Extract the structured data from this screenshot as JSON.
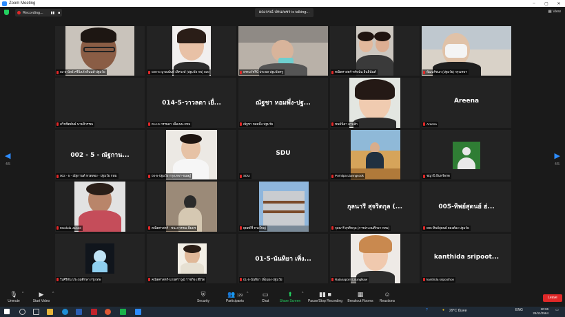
{
  "window": {
    "title": "Zoom Meeting",
    "ctrl_min": "–",
    "ctrl_max": "▢",
    "ctrl_close": "✕"
  },
  "topbar": {
    "recording": "Recording...",
    "pause": "▮▮",
    "stop": "■",
    "talking": "ผดงกรณ์ ปทนเพชร is talking...",
    "view": "View"
  },
  "nav": {
    "left_arrow": "◀",
    "right_arrow": "▶",
    "page_left": "4/5",
    "page_right": "4/5"
  },
  "tiles": [
    {
      "label": "02-5-นัทธ์ ศรีนิลภักดีนนท์-ปฐมวัย"
    },
    {
      "label": "020-5 ญาณนันท์ เลิศวงษ์ (ปฐมวัย กพ) 020"
    },
    {
      "label": "ธรรมวัชรินี ประพล ปฐมวัยครู"
    },
    {
      "label": "คณิตศาสตร์-ทรัพนัน อินธินันท์"
    },
    {
      "label": "พัฒนรัชนก (ปฐมวัย) กรุงเทพฯ"
    },
    {
      "label": "สวิชชิตพันธ์ นามจิวรรณ",
      "big": ""
    },
    {
      "label": "014-5-วรรพดา เนื่อเนพ-กทม",
      "big": "014-5-วาวลดา เยื่..."
    },
    {
      "label": "ณัฐชา หอมพึ่ง-ปฐมวัย",
      "big": "ณัฐชา หอมพึ่ง-ปฐ..."
    },
    {
      "label": "ชนม์นิสา อาบสัก"
    },
    {
      "label": "Areena",
      "big": "Areena"
    },
    {
      "label": "002 - 5 - ณัฐกานต์ ทวดทอง - ปฐมวัย กทม",
      "big": "002 - 5 - ณัฐกาน..."
    },
    {
      "label": "04-5-ปฐมวัย กรุงเทพฯ-ขนษฏ์"
    },
    {
      "label": "SDU",
      "big": "SDU"
    },
    {
      "label": "Porntipa Lianngsook"
    },
    {
      "label": "ชญานิ อินทร์พรต"
    },
    {
      "label": "Mookda Jaisee"
    },
    {
      "label": "คณิตศาสตร์ - ชนะกวรรณ พิมพร"
    },
    {
      "label": "ยุพดพีรี่-ทวงใหญ่"
    },
    {
      "label": "กุลนารี สุจริตกุล (การประถมศึกษา-กทม)",
      "big": "กุลนารี สุจริตกุล (..."
    },
    {
      "label": "005-ทิพย์สุดนย์ ฮองต์อง ปฐมวัย",
      "big": "005-ทิพย์สุดนย์ ฮ่..."
    },
    {
      "label": "ใบศิริพัน ประถมศึกษา กรุงเทพ"
    },
    {
      "label": "คณิตศาสตร์-นายศราวุฒิ ราชกิจ เจ๊ยิโต"
    },
    {
      "label": "01-5-นันทิยา เพิ่งแผง-ปฐมวัย",
      "big": "01-5-นันทิยา เพิ่ง..."
    },
    {
      "label": "Ratanaporn Lounglkaw"
    },
    {
      "label": "kanthida sripoothon",
      "big": "kanthida sripoot..."
    }
  ],
  "toolbar": {
    "unmute": "Unmute",
    "start_video": "Start Video",
    "security": "Security",
    "participants": "Participants",
    "participants_count": "129",
    "chat": "Chat",
    "share_screen": "Share Screen",
    "recording": "Pause/Stop Recording",
    "breakout": "Breakout Rooms",
    "reactions": "Reactions",
    "leave": "Leave"
  },
  "taskbar": {
    "weather": "29°C มีแดด",
    "lang": "ENG",
    "time": "10:36",
    "date": "26/11/2564"
  },
  "colors": {
    "accent": "#2d8cff",
    "leave": "#e02828",
    "share": "#23d160",
    "tile_bg": "#232323"
  }
}
